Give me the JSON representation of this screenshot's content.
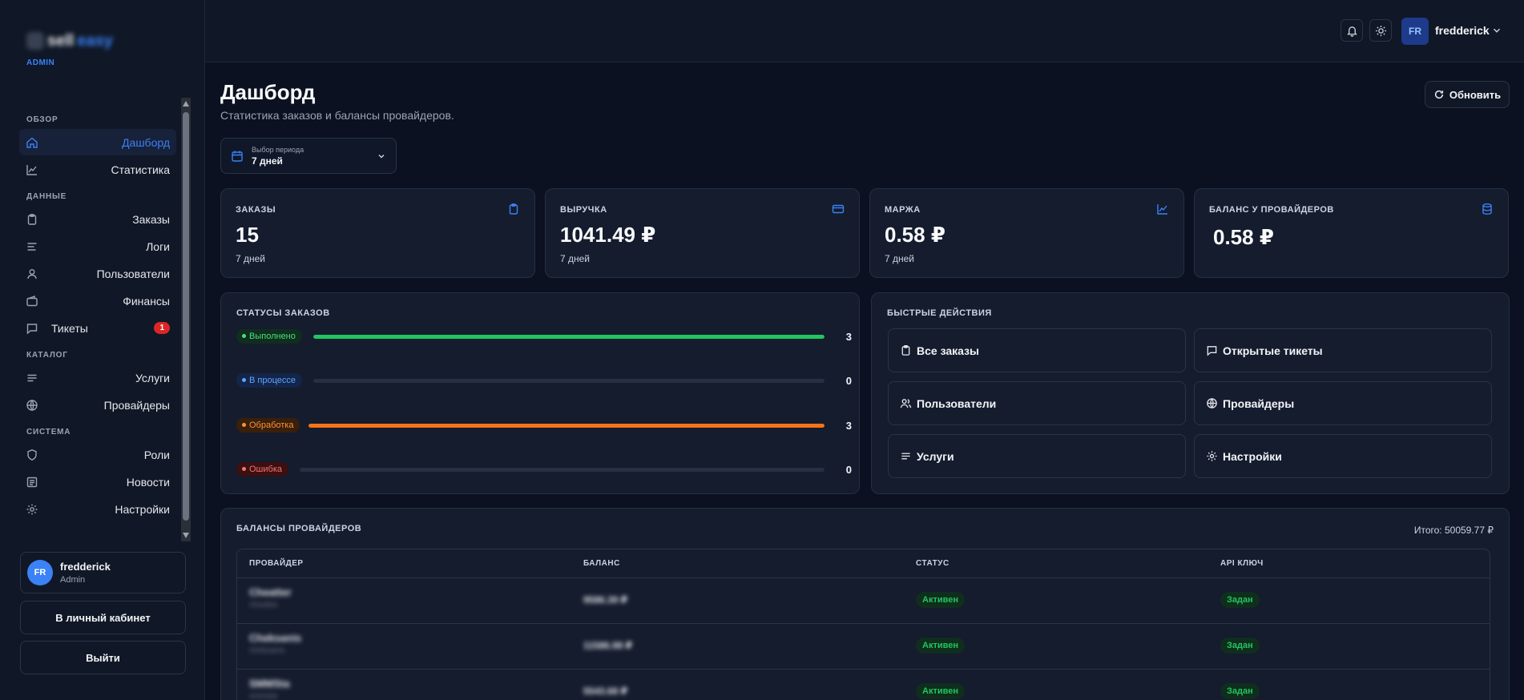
{
  "brand": {
    "name_part1": "sell",
    "name_part2": "easy",
    "role_tag": "ADMIN"
  },
  "sidebar": {
    "sections": {
      "overview": "ОБЗОР",
      "data": "ДАННЫЕ",
      "catalog": "КАТАЛОГ",
      "system": "СИСТЕМА"
    },
    "items": {
      "dashboard": "Дашборд",
      "stats": "Статистика",
      "orders": "Заказы",
      "logs": "Логи",
      "users": "Пользователи",
      "finance": "Финансы",
      "tickets": "Тикеты",
      "tickets_badge": "1",
      "services": "Услуги",
      "providers": "Провайдеры",
      "roles": "Роли",
      "news": "Новости",
      "settings": "Настройки"
    },
    "user": {
      "initials": "FR",
      "name": "fredderick",
      "role": "Admin"
    },
    "cabinet_button": "В личный кабинет",
    "logout_button": "Выйти"
  },
  "header": {
    "initials": "FR",
    "username": "fredderick"
  },
  "page": {
    "title": "Дашборд",
    "subtitle": "Статистика заказов и балансы провайдеров.",
    "refresh_label": "Обновить",
    "period": {
      "caption": "Выбор периода",
      "value": "7 дней"
    }
  },
  "stats": [
    {
      "label": "ЗАКАЗЫ",
      "value": "15",
      "sub": "7 дней",
      "icon": "clipboard-icon"
    },
    {
      "label": "ВЫРУЧКА",
      "value": "1041.49 ₽",
      "sub": "7 дней",
      "icon": "credit-card-icon"
    },
    {
      "label": "МАРЖА",
      "value": "0.58 ₽",
      "sub": "7 дней",
      "icon": "line-chart-icon"
    },
    {
      "label": "БАЛАНС У ПРОВАЙДЕРОВ",
      "value": "0.58 ₽",
      "sub": "",
      "icon": "database-icon"
    }
  ],
  "order_statuses": {
    "title": "СТАТУСЫ ЗАКАЗОВ",
    "items": [
      {
        "label": "Выполнено",
        "count": "3",
        "fraction": 1.0,
        "color": "#22c55e",
        "bg": "#0f2e1d",
        "text": "#4ade80"
      },
      {
        "label": "В процессе",
        "count": "0",
        "fraction": 0.0,
        "color": "#3b82f6",
        "bg": "#13254a",
        "text": "#60a5fa"
      },
      {
        "label": "Обработка",
        "count": "3",
        "fraction": 1.0,
        "color": "#f97316",
        "bg": "#3a1f0a",
        "text": "#fb923c"
      },
      {
        "label": "Ошибка",
        "count": "0",
        "fraction": 0.0,
        "color": "#ef4444",
        "bg": "#3a1010",
        "text": "#f87171"
      }
    ]
  },
  "quick_actions": {
    "title": "БЫСТРЫЕ ДЕЙСТВИЯ",
    "all_orders": "Все заказы",
    "open_tickets": "Открытые тикеты",
    "users": "Пользователи",
    "providers": "Провайдеры",
    "services": "Услуги",
    "settings": "Настройки"
  },
  "provider_balances": {
    "title": "БАЛАНСЫ ПРОВАЙДЕРОВ",
    "total": "Итого: 50059.77 ₽",
    "columns": [
      "ПРОВАЙДЕР",
      "БАЛАНС",
      "СТАТУС",
      "API КЛЮЧ"
    ],
    "rows": [
      {
        "name": "Cheatter",
        "id": "cheatter",
        "balance": "9586.39 ₽",
        "status": "Активен",
        "api": "Задан"
      },
      {
        "name": "Cheksanis",
        "id": "cheksanis",
        "balance": "11586.98 ₽",
        "status": "Активен",
        "api": "Задан"
      },
      {
        "name": "SMMSta",
        "id": "smmsta",
        "balance": "5543.68 ₽",
        "status": "Активен",
        "api": "Задан"
      }
    ]
  },
  "colors": {
    "accent": "#3b82f6",
    "background": "#0b1120",
    "panel": "#141c2e"
  }
}
